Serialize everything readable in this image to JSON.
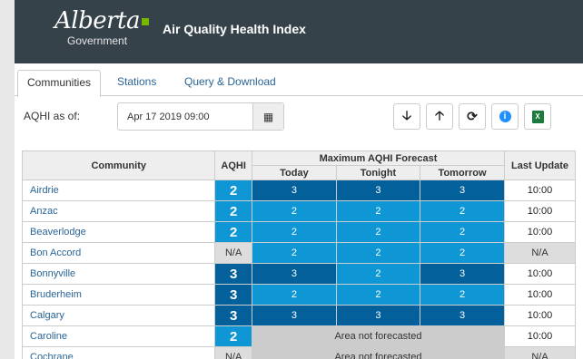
{
  "brand": {
    "script": "Alberta",
    "sub": "Government"
  },
  "app_title": "Air Quality Health Index",
  "tabs": [
    {
      "label": "Communities",
      "active": true
    },
    {
      "label": "Stations",
      "active": false
    },
    {
      "label": "Query & Download",
      "active": false
    }
  ],
  "aqhi_label": "AQHI as of:",
  "date_value": "Apr 17 2019 09:00",
  "toolbar_icons": [
    "calendar-icon",
    "arrow-down-icon",
    "arrow-up-icon",
    "refresh-icon",
    "info-icon",
    "excel-icon"
  ],
  "table": {
    "headers": {
      "community": "Community",
      "aqhi": "AQHI",
      "forecast_group": "Maximum AQHI Forecast",
      "today": "Today",
      "tonight": "Tonight",
      "tomorrow": "Tomorrow",
      "last_update": "Last Update"
    },
    "rows": [
      {
        "name": "Airdrie",
        "aqhi": "2",
        "today": "3",
        "tonight": "3",
        "tomorrow": "3",
        "update": "10:00"
      },
      {
        "name": "Anzac",
        "aqhi": "2",
        "today": "2",
        "tonight": "2",
        "tomorrow": "2",
        "update": "10:00"
      },
      {
        "name": "Beaverlodge",
        "aqhi": "2",
        "today": "2",
        "tonight": "2",
        "tomorrow": "2",
        "update": "10:00"
      },
      {
        "name": "Bon Accord",
        "aqhi": "N/A",
        "today": "2",
        "tonight": "2",
        "tomorrow": "2",
        "update": "N/A"
      },
      {
        "name": "Bonnyville",
        "aqhi": "3",
        "today": "3",
        "tonight": "2",
        "tomorrow": "3",
        "update": "10:00"
      },
      {
        "name": "Bruderheim",
        "aqhi": "3",
        "today": "2",
        "tonight": "2",
        "tomorrow": "2",
        "update": "10:00"
      },
      {
        "name": "Calgary",
        "aqhi": "3",
        "today": "3",
        "tonight": "3",
        "tomorrow": "3",
        "update": "10:00"
      },
      {
        "name": "Caroline",
        "aqhi": "2",
        "not_forecasted": "Area not forecasted",
        "update": "10:00"
      },
      {
        "name": "Cochrane",
        "aqhi": "N/A",
        "not_forecasted": "Area not forecasted",
        "update": "N/A"
      }
    ]
  },
  "colors": {
    "header_bg": "#36424a",
    "level_2": "#0e97d4",
    "level_3": "#04609a",
    "link": "#2a6496",
    "na_bg": "#dddddd"
  }
}
